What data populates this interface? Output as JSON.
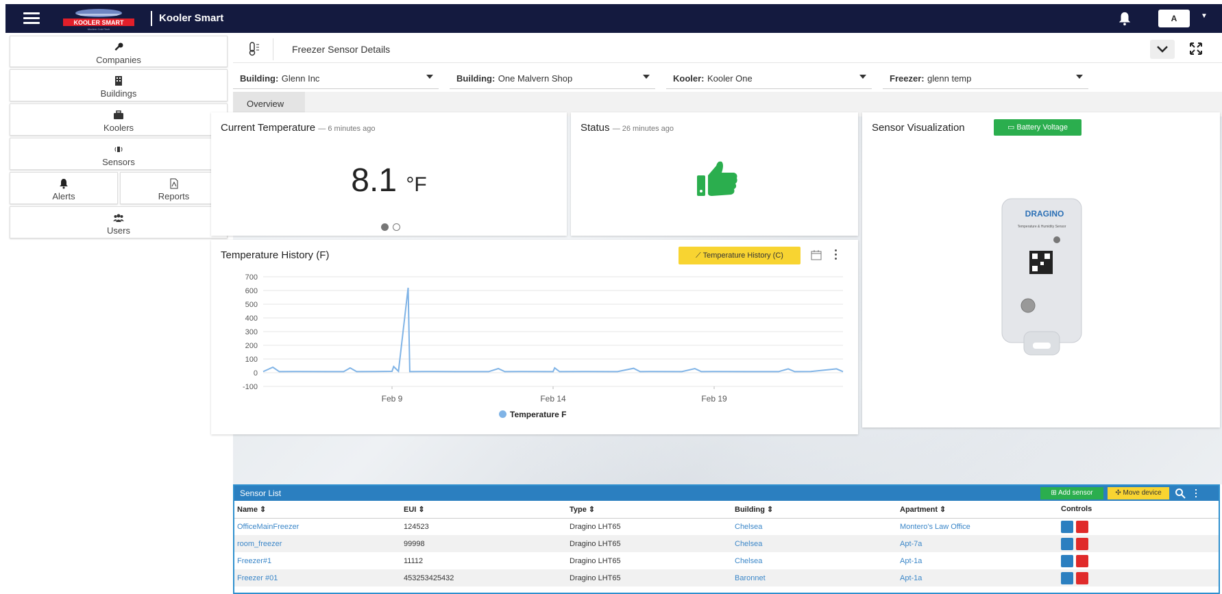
{
  "header": {
    "app_title": "Kooler Smart",
    "logo_text": "KOOLER SMART",
    "logo_tagline": "Modern Cold Tech",
    "user_initial": "A"
  },
  "sidebar": {
    "items": [
      {
        "label": "Companies",
        "icon": "key-icon"
      },
      {
        "label": "Buildings",
        "icon": "building-icon"
      },
      {
        "label": "Koolers",
        "icon": "toolbox-icon"
      },
      {
        "label": "Sensors",
        "icon": "sensor-icon"
      },
      {
        "label": "Alerts",
        "icon": "bell-icon"
      },
      {
        "label": "Reports",
        "icon": "pdf-file-icon"
      },
      {
        "label": "Users",
        "icon": "users-icon"
      }
    ]
  },
  "panel": {
    "title": "Freezer Sensor Details"
  },
  "filters": [
    {
      "key": "Building:",
      "value": "Glenn Inc"
    },
    {
      "key": "Building:",
      "value": "One Malvern Shop"
    },
    {
      "key": "Kooler:",
      "value": "Kooler One"
    },
    {
      "key": "Freezer:",
      "value": "glenn temp"
    }
  ],
  "tabs": [
    {
      "label": "Overview",
      "active": true
    }
  ],
  "current_temp": {
    "title": "Current Temperature",
    "age": "— 6 minutes ago",
    "value": "8.1",
    "unit": "°F",
    "carousel_pages": 2,
    "carousel_active": 1
  },
  "status": {
    "title": "Status",
    "age": "— 26 minutes ago",
    "icon": "thumbs-up-icon",
    "color": "#2bae4e"
  },
  "visualization": {
    "title": "Sensor Visualization",
    "battery_button": "Battery Voltage",
    "device_brand": "DRAGINO",
    "device_label": "Temperature & Humidity Sensor"
  },
  "history": {
    "title": "Temperature History (F)",
    "toggle_button": "Temperature History (C)",
    "legend": "Temperature F"
  },
  "chart_data": {
    "type": "line",
    "title": "Temperature History (F)",
    "xlabel": "",
    "ylabel": "",
    "ylim": [
      -100,
      700
    ],
    "yticks": [
      700,
      600,
      500,
      400,
      300,
      200,
      100,
      0,
      -100
    ],
    "xticks": [
      "Feb 9",
      "Feb 14",
      "Feb 19"
    ],
    "grid": true,
    "legend_position": "bottom",
    "series": [
      {
        "name": "Temperature F",
        "color": "#7fb3e6",
        "points": [
          [
            "Feb 5",
            8
          ],
          [
            "Feb 5.3",
            40
          ],
          [
            "Feb 5.5",
            8
          ],
          [
            "Feb 6",
            9
          ],
          [
            "Feb 7",
            8
          ],
          [
            "Feb 7.5",
            8
          ],
          [
            "Feb 7.7",
            35
          ],
          [
            "Feb 7.9",
            8
          ],
          [
            "Feb 8.5",
            9
          ],
          [
            "Feb 9",
            10
          ],
          [
            "Feb 9.05",
            45
          ],
          [
            "Feb 9.2",
            10
          ],
          [
            "Feb 9.5",
            620
          ],
          [
            "Feb 9.55",
            8
          ],
          [
            "Feb 10",
            9
          ],
          [
            "Feb 11",
            8
          ],
          [
            "Feb 12",
            8
          ],
          [
            "Feb 12.3",
            30
          ],
          [
            "Feb 12.5",
            8
          ],
          [
            "Feb 13",
            9
          ],
          [
            "Feb 14",
            8
          ],
          [
            "Feb 14.05",
            35
          ],
          [
            "Feb 14.2",
            8
          ],
          [
            "Feb 15",
            9
          ],
          [
            "Feb 16",
            8
          ],
          [
            "Feb 16.5",
            32
          ],
          [
            "Feb 16.7",
            8
          ],
          [
            "Feb 17",
            9
          ],
          [
            "Feb 18",
            8
          ],
          [
            "Feb 18.4",
            30
          ],
          [
            "Feb 18.6",
            8
          ],
          [
            "Feb 19",
            9
          ],
          [
            "Feb 20",
            8
          ],
          [
            "Feb 21",
            8
          ],
          [
            "Feb 21.3",
            28
          ],
          [
            "Feb 21.5",
            8
          ],
          [
            "Feb 22",
            9
          ],
          [
            "Feb 22.8",
            28
          ],
          [
            "Feb 23",
            8
          ]
        ]
      }
    ]
  },
  "sensor_list": {
    "title": "Sensor List",
    "add_button": "Add sensor",
    "move_button": "Move device",
    "columns": [
      "Name ⇕",
      "EUI ⇕",
      "Type ⇕",
      "Building ⇕",
      "Apartment ⇕",
      "Controls"
    ],
    "rows": [
      {
        "name": "OfficeMainFreezer",
        "eui": "124523",
        "type": "Dragino LHT65",
        "building": "Chelsea",
        "apartment": "Montero's Law Office"
      },
      {
        "name": "room_freezer",
        "eui": "99998",
        "type": "Dragino LHT65",
        "building": "Chelsea",
        "apartment": "Apt-7a"
      },
      {
        "name": "Freezer#1",
        "eui": "11112",
        "type": "Dragino LHT65",
        "building": "Chelsea",
        "apartment": "Apt-1a"
      },
      {
        "name": "Freezer #01",
        "eui": "453253425432",
        "type": "Dragino LHT65",
        "building": "Baronnet",
        "apartment": "Apt-1a"
      }
    ]
  }
}
